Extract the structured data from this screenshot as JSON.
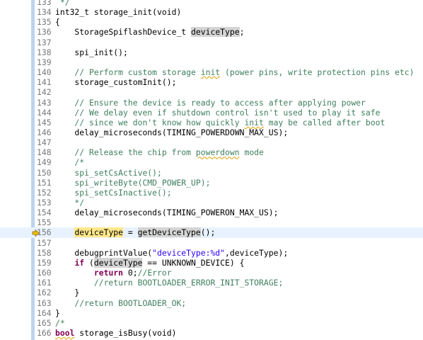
{
  "colors": {
    "keyword": "#7f0055",
    "comment": "#3f7f5f",
    "string": "#2a00ff",
    "line_number": "#787878",
    "current_line_bg": "#e8f2fe",
    "occurrence_bg": "#d4d4d4",
    "debug_arrow": "#f0c000"
  },
  "editor": {
    "first_line": 133,
    "current_line": 156,
    "lines": [
      {
        "n": "133",
        "tokens": [
          {
            "t": " */",
            "c": "cm"
          }
        ]
      },
      {
        "n": "134",
        "tokens": [
          {
            "t": "int32_t storage_init(void)",
            "c": "plain"
          }
        ]
      },
      {
        "n": "135",
        "tokens": [
          {
            "t": "{",
            "c": "plain"
          }
        ]
      },
      {
        "n": "136",
        "tokens": [
          {
            "t": "    StorageSpiflashDevice_t ",
            "c": "plain"
          },
          {
            "t": "deviceType",
            "c": "occ"
          },
          {
            "t": ";",
            "c": "plain"
          }
        ]
      },
      {
        "n": "137",
        "tokens": []
      },
      {
        "n": "138",
        "tokens": [
          {
            "t": "    spi_init();",
            "c": "plain"
          }
        ]
      },
      {
        "n": "139",
        "tokens": []
      },
      {
        "n": "140",
        "tokens": [
          {
            "t": "    // Perform custom storage ",
            "c": "cm"
          },
          {
            "t": "init",
            "c": "cmsq"
          },
          {
            "t": " (power pins, write protection pins etc)",
            "c": "cm"
          }
        ]
      },
      {
        "n": "141",
        "tokens": [
          {
            "t": "    storage_customInit();",
            "c": "plain"
          }
        ]
      },
      {
        "n": "142",
        "tokens": []
      },
      {
        "n": "143",
        "tokens": [
          {
            "t": "    // Ensure the device is ready to access after applying power",
            "c": "cm"
          }
        ]
      },
      {
        "n": "144",
        "tokens": [
          {
            "t": "    // We delay even if shutdown control isn't used to play it safe",
            "c": "cm"
          }
        ]
      },
      {
        "n": "145",
        "tokens": [
          {
            "t": "    // since we don't know how quickly ",
            "c": "cm"
          },
          {
            "t": "init",
            "c": "cmsq"
          },
          {
            "t": " may be called after boot",
            "c": "cm"
          }
        ]
      },
      {
        "n": "146",
        "tokens": [
          {
            "t": "    delay_microseconds(TIMING_POWERDOWN_MAX_US);",
            "c": "plain"
          }
        ]
      },
      {
        "n": "147",
        "tokens": []
      },
      {
        "n": "148",
        "tokens": [
          {
            "t": "    // Release the chip from ",
            "c": "cm"
          },
          {
            "t": "powerdown",
            "c": "cmsq"
          },
          {
            "t": " mode",
            "c": "cm"
          }
        ]
      },
      {
        "n": "149",
        "tokens": [
          {
            "t": "    /*",
            "c": "cm"
          }
        ]
      },
      {
        "n": "150",
        "tokens": [
          {
            "t": "    spi_setCsActive();",
            "c": "cm"
          }
        ]
      },
      {
        "n": "151",
        "tokens": [
          {
            "t": "    spi_writeByte(CMD_POWER_UP);",
            "c": "cm"
          }
        ]
      },
      {
        "n": "152",
        "tokens": [
          {
            "t": "    spi_setCsInactive();",
            "c": "cm"
          }
        ]
      },
      {
        "n": "153",
        "tokens": [
          {
            "t": "    */",
            "c": "cm"
          }
        ]
      },
      {
        "n": "154",
        "tokens": [
          {
            "t": "    delay_microseconds(TIMING_POWERON_MAX_US);",
            "c": "plain"
          }
        ]
      },
      {
        "n": "155",
        "tokens": []
      },
      {
        "n": "156",
        "tokens": [
          {
            "t": "    ",
            "c": "plain"
          },
          {
            "t": "deviceType",
            "c": "cur"
          },
          {
            "t": " = ",
            "c": "plain"
          },
          {
            "t": "getDeviceType",
            "c": "occ"
          },
          {
            "t": "();",
            "c": "plain"
          }
        ]
      },
      {
        "n": "157",
        "tokens": []
      },
      {
        "n": "158",
        "tokens": [
          {
            "t": "    debugprintValue(",
            "c": "plain"
          },
          {
            "t": "\"deviceType:%d\"",
            "c": "st"
          },
          {
            "t": ",deviceType);",
            "c": "plain"
          }
        ]
      },
      {
        "n": "159",
        "tokens": [
          {
            "t": "    ",
            "c": "plain"
          },
          {
            "t": "if",
            "c": "kw"
          },
          {
            "t": " (",
            "c": "plain"
          },
          {
            "t": "deviceType",
            "c": "occ"
          },
          {
            "t": " == UNKNOWN_DEVICE) {",
            "c": "plain"
          }
        ]
      },
      {
        "n": "160",
        "tokens": [
          {
            "t": "        ",
            "c": "plain"
          },
          {
            "t": "return",
            "c": "kw"
          },
          {
            "t": " 0;",
            "c": "plain"
          },
          {
            "t": "//Error",
            "c": "cm"
          }
        ]
      },
      {
        "n": "161",
        "tokens": [
          {
            "t": "        //return BOOTLOADER_ERROR_INIT_STORAGE;",
            "c": "cm"
          }
        ]
      },
      {
        "n": "162",
        "tokens": [
          {
            "t": "    }",
            "c": "plain"
          }
        ]
      },
      {
        "n": "163",
        "tokens": [
          {
            "t": "    //return BOOTLOADER_OK;",
            "c": "cm"
          }
        ]
      },
      {
        "n": "164",
        "tokens": [
          {
            "t": "}",
            "c": "plain"
          }
        ]
      },
      {
        "n": "165",
        "tokens": [
          {
            "t": "/*",
            "c": "cm"
          }
        ]
      },
      {
        "n": "166",
        "tokens": [
          {
            "t": "bool",
            "c": "kwsq"
          },
          {
            "t": " storage_isBusy(void)",
            "c": "plain"
          }
        ]
      }
    ]
  }
}
